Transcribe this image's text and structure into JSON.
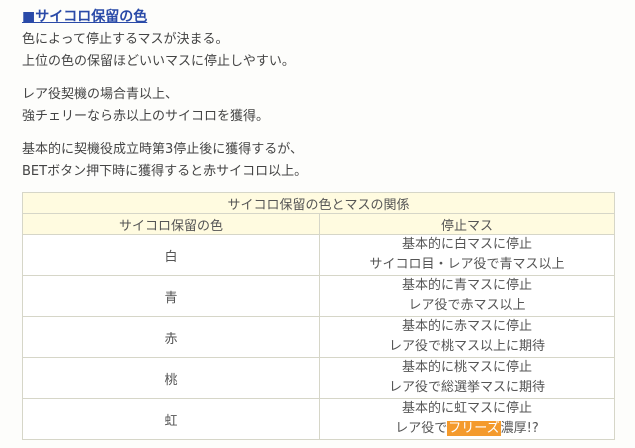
{
  "heading": "■サイコロ保留の色",
  "paragraphs": [
    [
      "色によって停止するマスが決まる。",
      "上位の色の保留ほどいいマスに停止しやすい。"
    ],
    [
      "レア役契機の場合青以上、",
      "強チェリーなら赤以上のサイコロを獲得。"
    ],
    [
      "基本的に契機役成立時第3停止後に獲得するが、",
      "BETボタン押下時に獲得すると赤サイコロ以上。"
    ]
  ],
  "table": {
    "caption": "サイコロ保留の色とマスの関係",
    "headers": [
      "サイコロ保留の色",
      "停止マス"
    ],
    "rows": [
      {
        "color": "白",
        "line1": "基本的に白マスに停止",
        "line2": "サイコロ目・レア役で青マス以上"
      },
      {
        "color": "青",
        "line1": "基本的に青マスに停止",
        "line2": "レア役で赤マス以上"
      },
      {
        "color": "赤",
        "line1": "基本的に赤マスに停止",
        "line2": "レア役で桃マス以上に期待"
      },
      {
        "color": "桃",
        "line1": "基本的に桃マスに停止",
        "line2": "レア役で総選挙マスに期待"
      },
      {
        "color": "虹",
        "line1": "基本的に虹マスに停止",
        "line2_pre": "レア役で",
        "line2_highlight": "フリーズ",
        "line2_post": "濃厚!?"
      }
    ]
  }
}
